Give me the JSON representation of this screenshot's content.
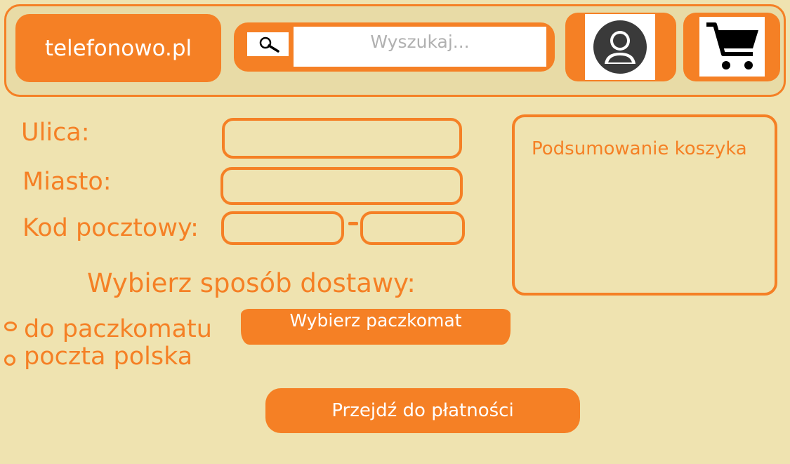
{
  "header": {
    "logo_text": "telefonowo.pl",
    "search": {
      "placeholder": "Wyszukaj..."
    },
    "icons": {
      "search": "magnifier-icon",
      "account": "user-avatar-icon",
      "cart": "shopping-cart-icon"
    }
  },
  "form": {
    "street_label": "Ulica:",
    "city_label": "Miasto:",
    "postal_label": "Kod pocztowy:"
  },
  "summary": {
    "title": "Podsumowanie koszyka"
  },
  "delivery": {
    "title": "Wybierz sposób dostawy:",
    "options": [
      "do paczkomatu",
      "poczta polska"
    ],
    "choose_locker_label": "Wybierz paczkomat"
  },
  "payment_button_label": "Przejdź do płatności",
  "colors": {
    "accent": "#F58025",
    "background": "#EFE3B0",
    "header_bg": "#E8DBA6"
  }
}
